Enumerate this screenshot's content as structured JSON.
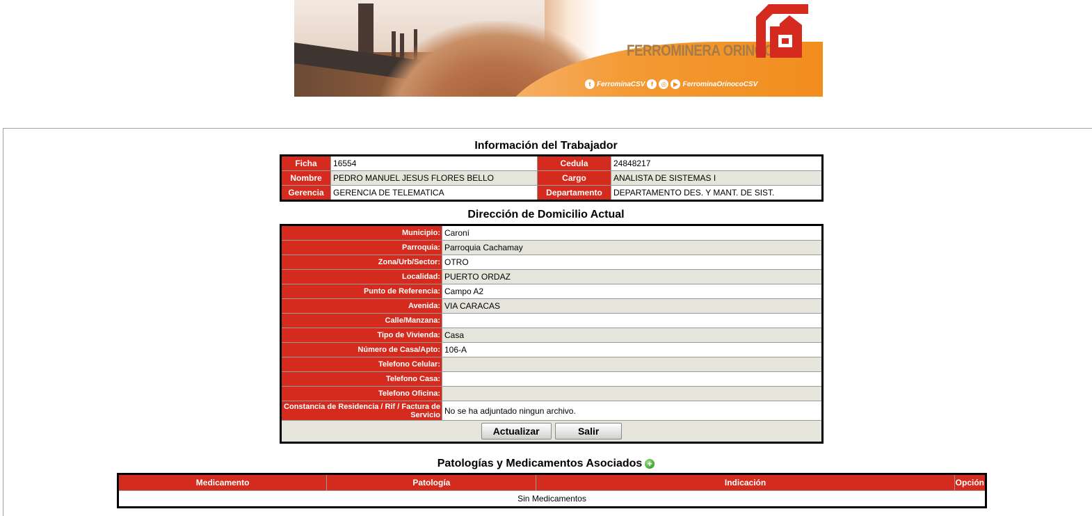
{
  "header": {
    "brand": "FERROMINERA ORINOCO",
    "social": {
      "twitter": "FerrominaCSV",
      "youtube": "FerrominaOrinocoCSV"
    },
    "brand_colors": {
      "red": "#d52b1e",
      "orange": "#f28a1a",
      "gold": "#a67b4a"
    }
  },
  "worker_info": {
    "title": "Información del Trabajador",
    "rows": [
      {
        "l1": "Ficha",
        "v1": "16554",
        "l2": "Cedula",
        "v2": "24848217"
      },
      {
        "l1": "Nombre",
        "v1": "PEDRO MANUEL JESUS FLORES BELLO",
        "l2": "Cargo",
        "v2": "ANALISTA DE SISTEMAS I"
      },
      {
        "l1": "Gerencia",
        "v1": "GERENCIA DE TELEMATICA",
        "l2": "Departamento",
        "v2": "DEPARTAMENTO DES. Y MANT. DE SIST."
      }
    ]
  },
  "address": {
    "title": "Dirección de Domicilio Actual",
    "rows": [
      {
        "label": "Municipio:",
        "value": "Caroní"
      },
      {
        "label": "Parroquia:",
        "value": "Parroquia Cachamay"
      },
      {
        "label": "Zona/Urb/Sector:",
        "value": "OTRO"
      },
      {
        "label": "Localidad:",
        "value": "PUERTO ORDAZ"
      },
      {
        "label": "Punto de Referencia:",
        "value": "Campo A2"
      },
      {
        "label": "Avenida:",
        "value": "VIA CARACAS"
      },
      {
        "label": "Calle/Manzana:",
        "value": ""
      },
      {
        "label": "Tipo de Vivienda:",
        "value": "Casa"
      },
      {
        "label": "Número de Casa/Apto:",
        "value": "106-A"
      },
      {
        "label": "Telefono Celular:",
        "value": ""
      },
      {
        "label": "Telefono Casa:",
        "value": ""
      },
      {
        "label": "Telefono Oficina:",
        "value": ""
      },
      {
        "label": "Constancia de Residencia / Rif / Factura de Servicio",
        "value": "No se ha adjuntado ningun archivo."
      }
    ],
    "buttons": {
      "update": "Actualizar",
      "exit": "Salir"
    }
  },
  "pathologies": {
    "title": "Patologías y Medicamentos Asociados",
    "columns": [
      "Medicamento",
      "Patología",
      "Indicación",
      "Opción"
    ],
    "empty_text": "Sin Medicamentos"
  }
}
